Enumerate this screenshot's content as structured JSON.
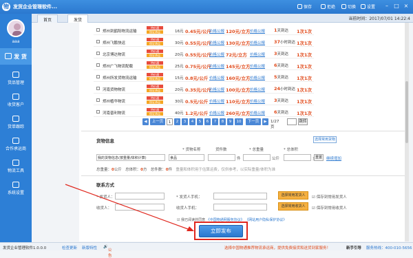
{
  "titlebar": {
    "title": "发货企业管理软件...",
    "items": [
      "保存",
      "拒绝",
      "切换",
      "设置"
    ]
  },
  "header": {
    "time_label": "当前时间：",
    "date": "2017/07/01",
    "clock": "14:22:4"
  },
  "sidebar": {
    "username": "aaa",
    "items": [
      {
        "label": "发 货"
      },
      {
        "label": "货品管理"
      },
      {
        "label": "收货客户"
      },
      {
        "label": "货单跟踪"
      },
      {
        "label": "合作承运商"
      },
      {
        "label": "物流工具"
      },
      {
        "label": "系统设置"
      }
    ]
  },
  "tabs": [
    {
      "label": "首页"
    },
    {
      "label": "发货"
    }
  ],
  "rows": [
    {
      "ship": "郑州到鹤阳物流运输",
      "tag1": "特价通",
      "tag2": "保证承运",
      "weight": "16元",
      "price1": "0.45元/公斤",
      "link": "价格公报",
      "price2": "120元/立方",
      "time_num": "1",
      "time_text": "天到达",
      "tickets": "1次1次"
    },
    {
      "ship": "郑州飞鹏快运",
      "tag1": "特价通",
      "tag2": "保证承运",
      "weight": "30元",
      "price1": "0.55元/公斤",
      "link": "价格公报",
      "price2": "130元/立方",
      "time_num": "37",
      "time_text": "小时到达",
      "tickets": "1次1次"
    },
    {
      "ship": "北京博达物流",
      "tag1": "特价通",
      "tag2": "保证承运",
      "weight": "20元",
      "price1": "0.55元/公斤",
      "link": "价格公报",
      "price2": "72元/立方",
      "time_num": "3",
      "time_text": "天到达",
      "tickets": "1次1次"
    },
    {
      "ship": "郑州广飞物流配载",
      "tag1": "特价通",
      "tag2": "保证承运",
      "weight": "25元",
      "price1": "0.75元/公斤",
      "link": "价格公报",
      "price2": "145元/立方",
      "time_num": "6",
      "time_text": "天到达",
      "tickets": "1次1次"
    },
    {
      "ship": "郑州所发货物流运输",
      "tag1": "特价通",
      "tag2": "保证承运",
      "weight": "15元",
      "price1": "0.8元/公斤",
      "link": "价格公报",
      "price2": "160元/立方",
      "time_num": "5",
      "time_text": "天到达",
      "tickets": "1次1次"
    },
    {
      "ship": "河南货物物流",
      "tag1": "特价通",
      "tag2": "保证承运",
      "weight": "20元",
      "price1": "0.35元/公斤",
      "link": "价格公报",
      "price2": "100元/立方",
      "time_num": "24",
      "time_text": "小时到达",
      "tickets": "1次1次"
    },
    {
      "ship": "郑州植华物流",
      "tag1": "特价通",
      "tag2": "保证承运",
      "weight": "30元",
      "price1": "0.5元/公斤",
      "link": "价格公报",
      "price2": "110元/立方",
      "time_num": "3",
      "time_text": "天到达",
      "tickets": "1次1次"
    },
    {
      "ship": "河南普利物流",
      "tag1": "特价通",
      "tag2": "保证承运",
      "weight": "40元",
      "price1": "1.2元/公斤",
      "link": "价格公报",
      "price2": "260元/立方",
      "time_num": "6",
      "time_text": "天到达",
      "tickets": "1次1次"
    }
  ],
  "pager": {
    "first": "◀",
    "prev": "上一页",
    "pages": [
      "1",
      "2",
      "3",
      "4",
      "5",
      "6",
      "7",
      "8",
      "9",
      "10"
    ],
    "next": "下一页",
    "last": "▶",
    "info": "1/27页",
    "go": "跳转"
  },
  "goods": {
    "title": "货物信息",
    "select_btn": "选择常用货物",
    "col_name": "* 货物名称",
    "col_count": "货件数",
    "col_weight": "* 总重量",
    "col_volume": "* 总体积",
    "goods_select": "我的货物信息(按重量/体积计算)",
    "category": "食品",
    "unit_jian": "件",
    "unit_kg": "公斤",
    "unit_m3": "立方",
    "reset": "重置",
    "add_link": "继续增加",
    "total_weight_label": "总重量：",
    "total_weight_val": "0",
    "total_weight_unit": "公斤",
    "total_volume_label": "总体积：",
    "total_volume_val": "0",
    "total_volume_unit": "方",
    "total_count_label": "总件数：",
    "total_count_val": "0",
    "total_count_unit": "件",
    "note": "重量和体积用于估算运费，仅供参考，以实际重量/体积为准"
  },
  "contact": {
    "title": "联系方式",
    "sender_label": "* 发货人：",
    "sender_phone_label": "* 发货人手机：",
    "sender_btn": "选择常用发货人",
    "sender_save": "保存到常用发货人",
    "receiver_label": "收货人：",
    "receiver_phone_label": "收货人手机：",
    "receiver_btn": "选择常用收货人",
    "receiver_save": "保存到常用收货人"
  },
  "agree": {
    "text": "我已阅读并同意",
    "link1": "《中国物通网服务协议》",
    "link2": "《网站用户隐私保护协议》"
  },
  "publish": "立即发布",
  "statusbar": {
    "app": "发货企业管理软件1.0.0.0",
    "update": "检查更新",
    "help": "新版特性",
    "notice": "公告",
    "promo": "选择中国物通推荐物流承运商，提供免费接货和送货到家服务！",
    "guide": "新手引导",
    "hotline": "服务热线：400-010-5656"
  },
  "colors": {
    "primary": "#2b78cf",
    "accent": "#e04b1c",
    "highlight": "#e0261c"
  }
}
